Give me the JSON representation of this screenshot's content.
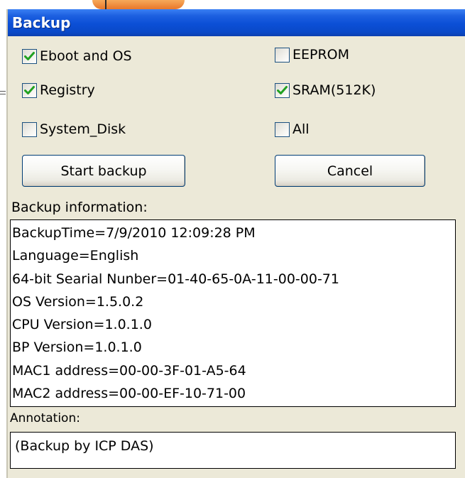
{
  "window": {
    "title": "Backup"
  },
  "options": [
    {
      "label": "Eboot and OS",
      "checked": true
    },
    {
      "label": "Registry",
      "checked": true
    },
    {
      "label": "System_Disk",
      "checked": false
    },
    {
      "label": "EEPROM",
      "checked": false
    },
    {
      "label": "SRAM(512K)",
      "checked": true
    },
    {
      "label": "All",
      "checked": false
    }
  ],
  "buttons": {
    "start": "Start backup",
    "cancel": "Cancel"
  },
  "backup_info": {
    "label": "Backup information:",
    "lines": [
      "BackupTime=7/9/2010 12:09:28 PM",
      "Language=English",
      "64-bit Searial Nunber=01-40-65-0A-11-00-00-71",
      "OS Version=1.5.0.2",
      "CPU Version=1.0.1.0",
      "BP Version=1.0.1.0",
      "MAC1 address=00-00-3F-01-A5-64",
      "MAC2 address=00-00-EF-10-71-00"
    ]
  },
  "annotation": {
    "label": "Annotation:",
    "value": "(Backup by ICP DAS)"
  },
  "colors": {
    "titlebar": "#0b4fd6",
    "check": "#21a121",
    "window_bg": "#ece9d8"
  }
}
